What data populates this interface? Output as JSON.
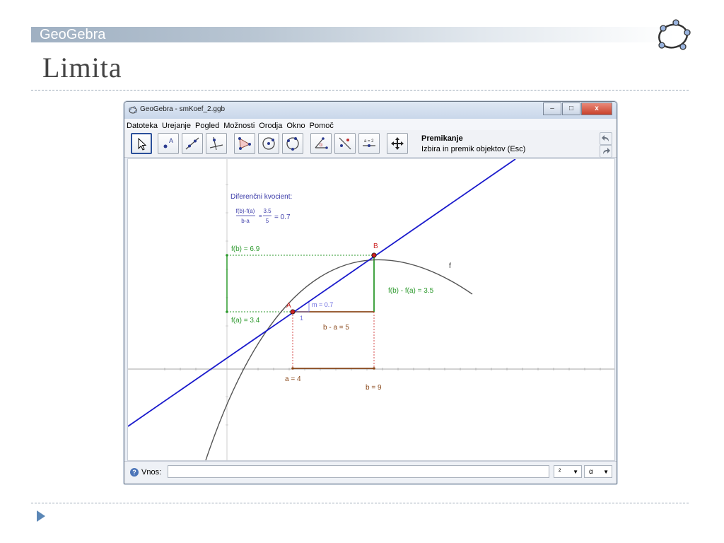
{
  "slide": {
    "banner": "GeoGebra",
    "title": "Limita"
  },
  "window": {
    "title": "GeoGebra - smKoef_2.ggb",
    "controls": [
      "–",
      "□",
      "x"
    ]
  },
  "menu": [
    "Datoteka",
    "Urejanje",
    "Pogled",
    "Možnosti",
    "Orodja",
    "Okno",
    "Pomoč"
  ],
  "toolbar": {
    "tools": [
      "move-tool",
      "point-tool",
      "line-tool",
      "perpendicular-tool",
      "polygon-tool",
      "circle-tool",
      "conic-tool",
      "angle-tool",
      "reflect-tool",
      "slider-tool",
      "move-view-tool"
    ],
    "active_tool_name": "Premikanje",
    "active_tool_help": "Izbira in premik objektov (Esc)"
  },
  "graphics": {
    "colors": {
      "tangent": "#1a1acc",
      "curve": "#555555",
      "green": "#2e9a2e",
      "brown": "#8b4a1c",
      "red": "#cc2222",
      "blue_text": "#3a3aa8"
    },
    "labels": {
      "diff_title": "Diferenčni kvocient:",
      "frac1_num": "f(b)-f(a)",
      "frac1_den": "b-a",
      "frac2_num": "3.5",
      "frac2_den": "5",
      "frac_eq": "=",
      "frac_result": "= 0.7",
      "fb": "f(b) = 6.9",
      "fa": "f(a) = 3.4",
      "point_a": "A",
      "point_b": "B",
      "curve_name": "f",
      "delta_y": "f(b) - f(a) = 3.5",
      "delta_x": "b - a = 5",
      "slope": "m = 0.7",
      "slope_run": "1",
      "a_val": "a = 4",
      "b_val": "b = 9"
    }
  },
  "inputbar": {
    "label": "Vnos:",
    "value": "",
    "combo1": "²",
    "combo2": "α"
  }
}
